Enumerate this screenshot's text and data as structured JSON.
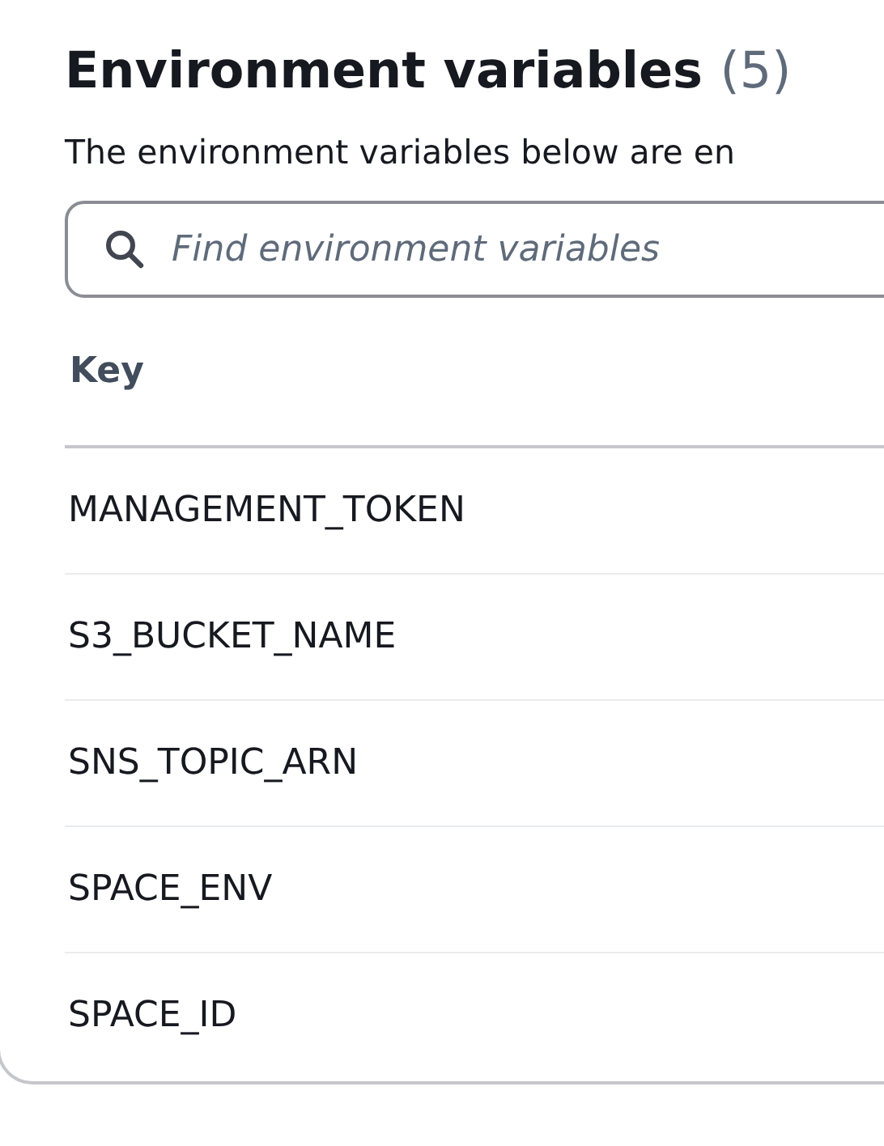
{
  "header": {
    "title": "Environment variables",
    "count": "(5)",
    "description": "The environment variables below are en"
  },
  "search": {
    "placeholder": "Find environment variables"
  },
  "table": {
    "columns": [
      "Key"
    ],
    "rows": [
      {
        "key": "MANAGEMENT_TOKEN"
      },
      {
        "key": "S3_BUCKET_NAME"
      },
      {
        "key": "SNS_TOPIC_ARN"
      },
      {
        "key": "SPACE_ENV"
      },
      {
        "key": "SPACE_ID"
      }
    ]
  }
}
